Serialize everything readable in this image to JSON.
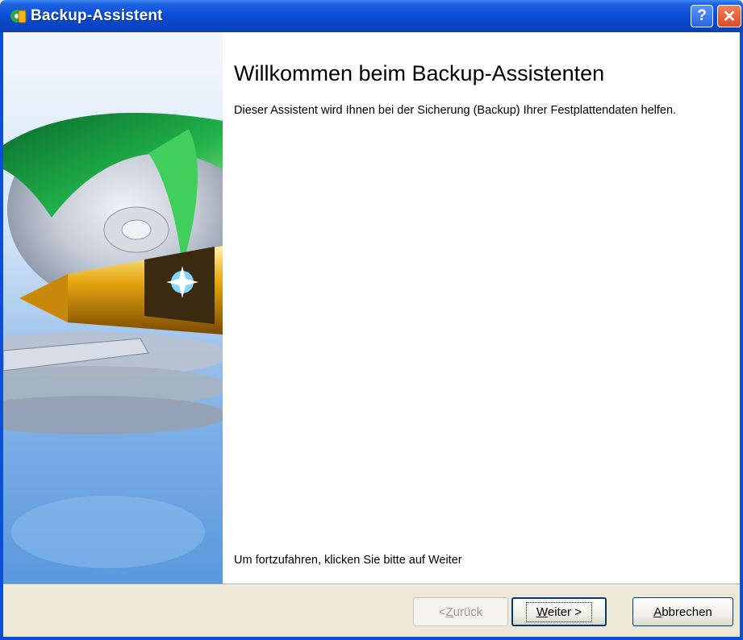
{
  "window": {
    "title": "Backup-Assistent",
    "help_button": "?",
    "close_button": "✕"
  },
  "content": {
    "heading": "Willkommen beim Backup-Assistenten",
    "description": "Dieser Assistent wird Ihnen bei der Sicherung (Backup) Ihrer Festplattendaten helfen.",
    "continue_hint": "Um fortzufahren, klicken Sie bitte auf Weiter"
  },
  "buttons": {
    "back": {
      "prefix": "< ",
      "mnemonic": "Z",
      "rest": "urück",
      "enabled": false
    },
    "next": {
      "mnemonic": "W",
      "rest": "eiter",
      "suffix": " >",
      "enabled": true
    },
    "cancel": {
      "mnemonic": "A",
      "rest": "bbrechen",
      "enabled": true
    }
  },
  "colors": {
    "titlebar": "#0a4fd6",
    "dialog_background": "#ece9d8",
    "content_background": "#ffffff"
  }
}
